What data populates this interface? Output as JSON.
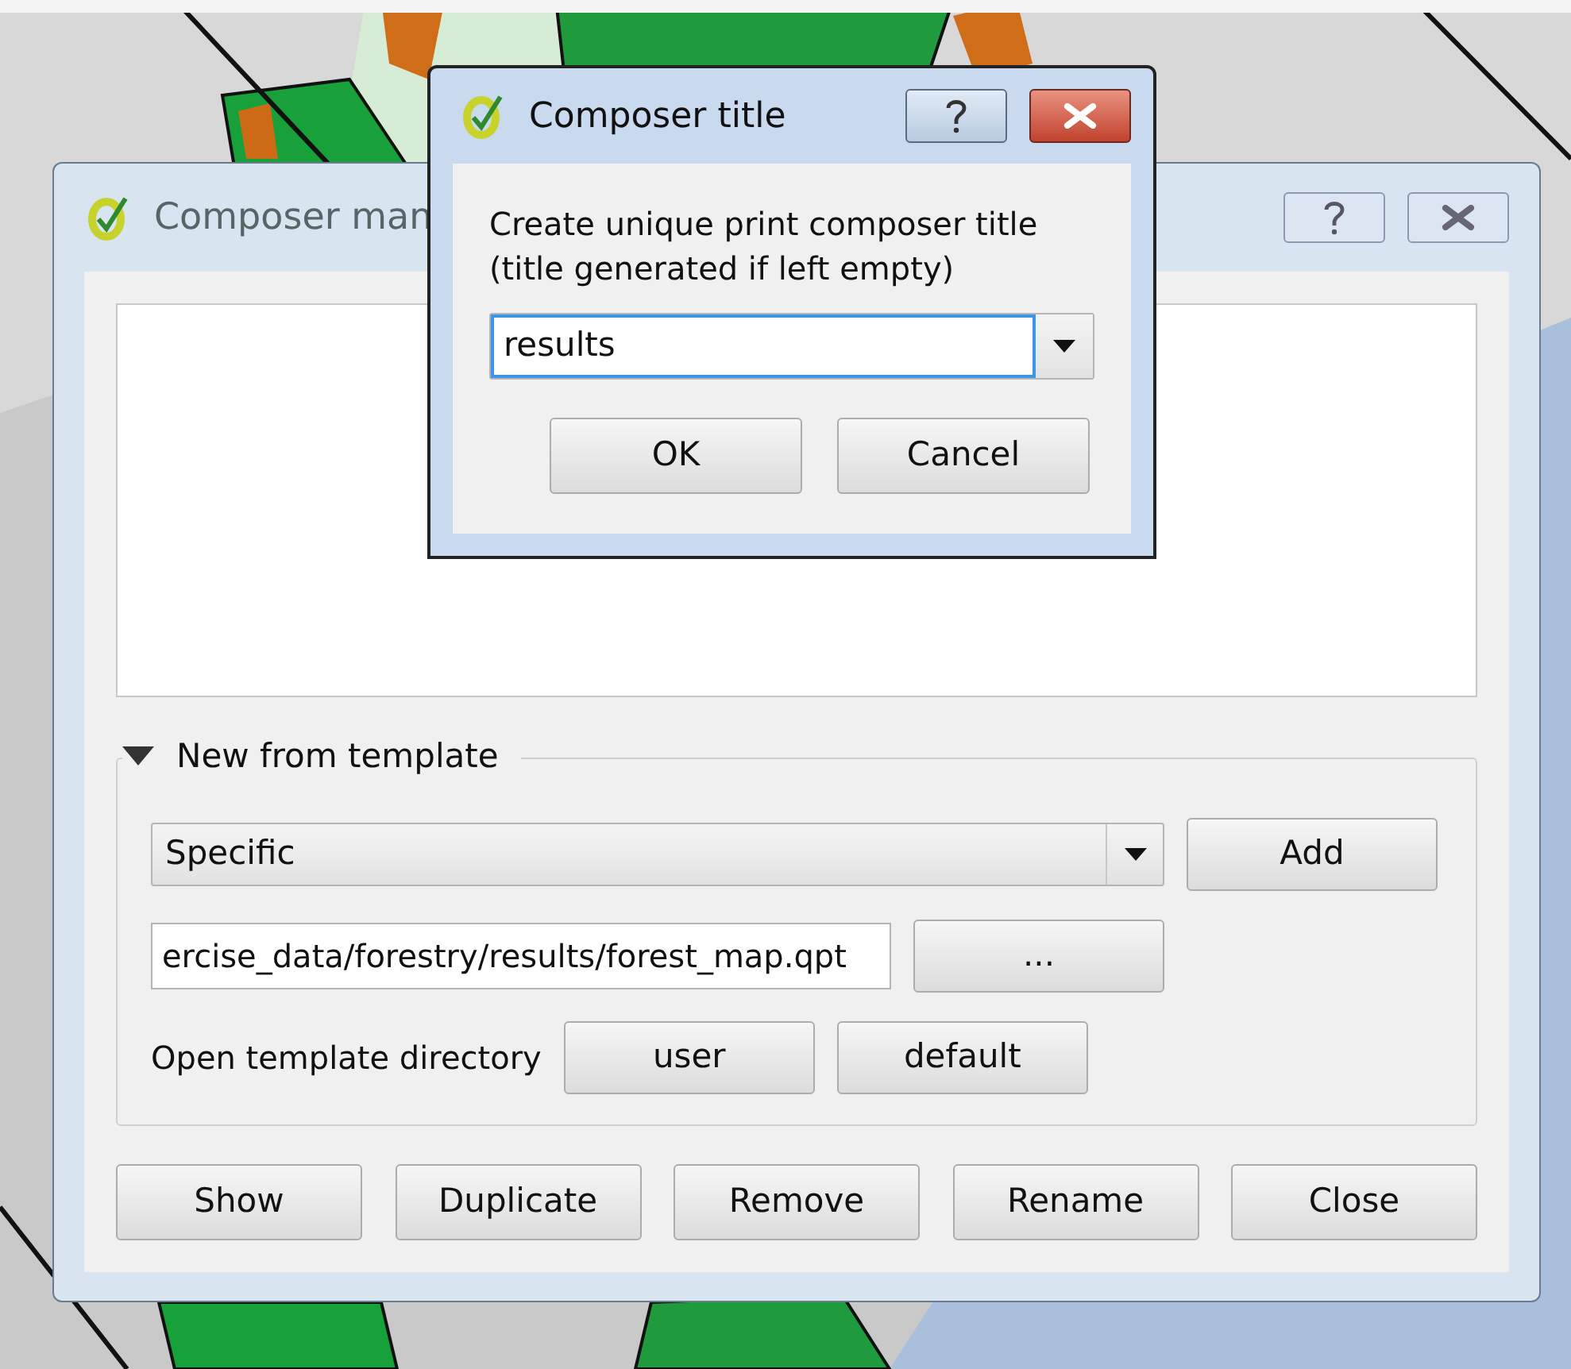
{
  "main_window": {
    "title": "Composer man",
    "template_group": {
      "title": "New from template",
      "expanded": true,
      "template_select": {
        "value": "Specific"
      },
      "add_button": "Add",
      "path_field": {
        "value": "ercise_data/forestry/results/forest_map.qpt"
      },
      "browse_button": "...",
      "directory_label": "Open template directory",
      "directory_buttons": [
        "user",
        "default"
      ]
    },
    "buttons": [
      "Show",
      "Duplicate",
      "Remove",
      "Rename",
      "Close"
    ]
  },
  "dialog": {
    "title": "Composer title",
    "prompt": "Create unique print composer title (title generated if left empty)",
    "title_field": {
      "value": "results"
    },
    "buttons": [
      "OK",
      "Cancel"
    ]
  }
}
